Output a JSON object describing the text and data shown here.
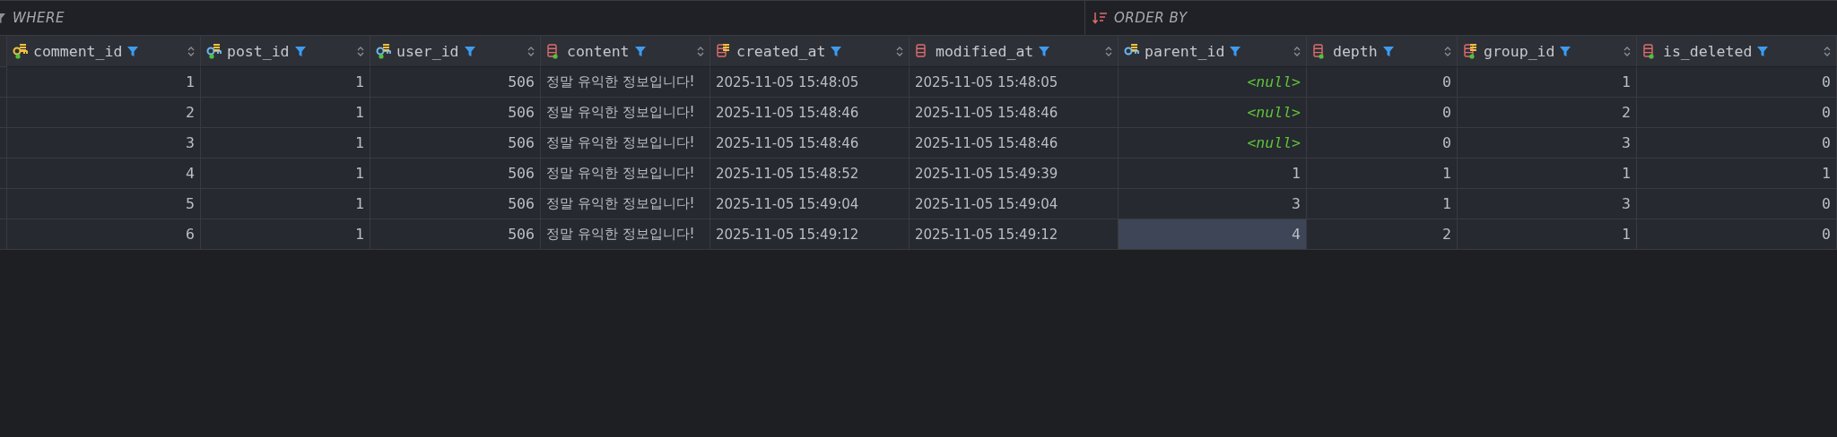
{
  "filter_bar": {
    "where_label": "WHERE",
    "order_by_label": "ORDER BY"
  },
  "columns": [
    {
      "name": "comment_id",
      "kind": "primary_key",
      "not_null": true,
      "numeric": true
    },
    {
      "name": "post_id",
      "kind": "foreign_key",
      "not_null": true,
      "numeric": true
    },
    {
      "name": "user_id",
      "kind": "foreign_key",
      "not_null": true,
      "numeric": true
    },
    {
      "name": "content",
      "kind": "column",
      "not_null": true,
      "numeric": false
    },
    {
      "name": "created_at",
      "kind": "indexed_column",
      "not_null": false,
      "numeric": false
    },
    {
      "name": "modified_at",
      "kind": "column",
      "not_null": false,
      "numeric": false
    },
    {
      "name": "parent_id",
      "kind": "indexed_foreign_key",
      "not_null": false,
      "numeric": true
    },
    {
      "name": "depth",
      "kind": "column",
      "not_null": true,
      "numeric": true
    },
    {
      "name": "group_id",
      "kind": "indexed_column",
      "not_null": true,
      "numeric": true
    },
    {
      "name": "is_deleted",
      "kind": "column",
      "not_null": true,
      "numeric": true
    }
  ],
  "rows": [
    {
      "cells": [
        {
          "value": "1",
          "kind": "value",
          "selected": false
        },
        {
          "value": "1",
          "kind": "value",
          "selected": false
        },
        {
          "value": "506",
          "kind": "value",
          "selected": false
        },
        {
          "value": "정말 유익한 정보입니다!",
          "kind": "value",
          "selected": false
        },
        {
          "value": "2025-11-05 15:48:05",
          "kind": "value",
          "selected": false
        },
        {
          "value": "2025-11-05 15:48:05",
          "kind": "value",
          "selected": false
        },
        {
          "value": "<null>",
          "kind": "null",
          "selected": false
        },
        {
          "value": "0",
          "kind": "value",
          "selected": false
        },
        {
          "value": "1",
          "kind": "value",
          "selected": false
        },
        {
          "value": "0",
          "kind": "value",
          "selected": false
        }
      ]
    },
    {
      "cells": [
        {
          "value": "2",
          "kind": "value",
          "selected": false
        },
        {
          "value": "1",
          "kind": "value",
          "selected": false
        },
        {
          "value": "506",
          "kind": "value",
          "selected": false
        },
        {
          "value": "정말 유익한 정보입니다!",
          "kind": "value",
          "selected": false
        },
        {
          "value": "2025-11-05 15:48:46",
          "kind": "value",
          "selected": false
        },
        {
          "value": "2025-11-05 15:48:46",
          "kind": "value",
          "selected": false
        },
        {
          "value": "<null>",
          "kind": "null",
          "selected": false
        },
        {
          "value": "0",
          "kind": "value",
          "selected": false
        },
        {
          "value": "2",
          "kind": "value",
          "selected": false
        },
        {
          "value": "0",
          "kind": "value",
          "selected": false
        }
      ]
    },
    {
      "cells": [
        {
          "value": "3",
          "kind": "value",
          "selected": false
        },
        {
          "value": "1",
          "kind": "value",
          "selected": false
        },
        {
          "value": "506",
          "kind": "value",
          "selected": false
        },
        {
          "value": "정말 유익한 정보입니다!",
          "kind": "value",
          "selected": false
        },
        {
          "value": "2025-11-05 15:48:46",
          "kind": "value",
          "selected": false
        },
        {
          "value": "2025-11-05 15:48:46",
          "kind": "value",
          "selected": false
        },
        {
          "value": "<null>",
          "kind": "null",
          "selected": false
        },
        {
          "value": "0",
          "kind": "value",
          "selected": false
        },
        {
          "value": "3",
          "kind": "value",
          "selected": false
        },
        {
          "value": "0",
          "kind": "value",
          "selected": false
        }
      ]
    },
    {
      "cells": [
        {
          "value": "4",
          "kind": "value",
          "selected": false
        },
        {
          "value": "1",
          "kind": "value",
          "selected": false
        },
        {
          "value": "506",
          "kind": "value",
          "selected": false
        },
        {
          "value": "정말 유익한 정보입니다!",
          "kind": "value",
          "selected": false
        },
        {
          "value": "2025-11-05 15:48:52",
          "kind": "value",
          "selected": false
        },
        {
          "value": "2025-11-05 15:49:39",
          "kind": "value",
          "selected": false
        },
        {
          "value": "1",
          "kind": "value",
          "selected": false
        },
        {
          "value": "1",
          "kind": "value",
          "selected": false
        },
        {
          "value": "1",
          "kind": "value",
          "selected": false
        },
        {
          "value": "1",
          "kind": "value",
          "selected": false
        }
      ]
    },
    {
      "cells": [
        {
          "value": "5",
          "kind": "value",
          "selected": false
        },
        {
          "value": "1",
          "kind": "value",
          "selected": false
        },
        {
          "value": "506",
          "kind": "value",
          "selected": false
        },
        {
          "value": "정말 유익한 정보입니다!",
          "kind": "value",
          "selected": false
        },
        {
          "value": "2025-11-05 15:49:04",
          "kind": "value",
          "selected": false
        },
        {
          "value": "2025-11-05 15:49:04",
          "kind": "value",
          "selected": false
        },
        {
          "value": "3",
          "kind": "value",
          "selected": false
        },
        {
          "value": "1",
          "kind": "value",
          "selected": false
        },
        {
          "value": "3",
          "kind": "value",
          "selected": false
        },
        {
          "value": "0",
          "kind": "value",
          "selected": false
        }
      ]
    },
    {
      "cells": [
        {
          "value": "6",
          "kind": "value",
          "selected": false
        },
        {
          "value": "1",
          "kind": "value",
          "selected": false
        },
        {
          "value": "506",
          "kind": "value",
          "selected": false
        },
        {
          "value": "정말 유익한 정보입니다!",
          "kind": "value",
          "selected": false
        },
        {
          "value": "2025-11-05 15:49:12",
          "kind": "value",
          "selected": false
        },
        {
          "value": "2025-11-05 15:49:12",
          "kind": "value",
          "selected": false
        },
        {
          "value": "4",
          "kind": "value",
          "selected": true
        },
        {
          "value": "2",
          "kind": "value",
          "selected": false
        },
        {
          "value": "1",
          "kind": "value",
          "selected": false
        },
        {
          "value": "0",
          "kind": "value",
          "selected": false
        }
      ]
    }
  ]
}
